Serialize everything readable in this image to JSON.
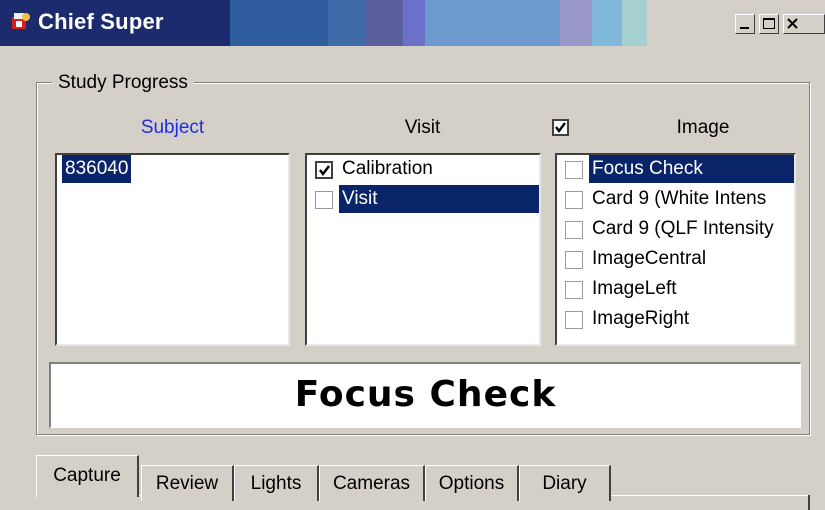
{
  "window": {
    "title": "Chief Super",
    "icon": "app-icon",
    "controls": [
      "minimize-icon",
      "maximize-icon",
      "close-icon"
    ]
  },
  "study_progress": {
    "legend": "Study Progress",
    "subject_header": "Subject",
    "visit_header": "Visit",
    "image_header": "Image",
    "image_header_checked": true,
    "subjects": [
      {
        "label": "836040",
        "selected": true
      }
    ],
    "visits": [
      {
        "label": "Calibration",
        "checked": true,
        "selected": false
      },
      {
        "label": "Visit",
        "checked": false,
        "selected": true
      }
    ],
    "images": [
      {
        "label": "Focus Check",
        "checked": false,
        "selected": true
      },
      {
        "label": "Card 9 (White Intens",
        "checked": false,
        "selected": false
      },
      {
        "label": "Card 9 (QLF Intensity",
        "checked": false,
        "selected": false
      },
      {
        "label": "ImageCentral",
        "checked": false,
        "selected": false
      },
      {
        "label": "ImageLeft",
        "checked": false,
        "selected": false
      },
      {
        "label": "ImageRight",
        "checked": false,
        "selected": false
      }
    ],
    "current_step": "Focus Check"
  },
  "tabs": [
    {
      "label": "Capture",
      "active": true
    },
    {
      "label": "Review",
      "active": false
    },
    {
      "label": "Lights",
      "active": false
    },
    {
      "label": "Cameras",
      "active": false
    },
    {
      "label": "Options",
      "active": false
    },
    {
      "label": "Diary",
      "active": false
    }
  ],
  "colors": {
    "selection": "#0a246a",
    "subject_header": "#1f2ce6",
    "face": "#d4d0c8"
  }
}
